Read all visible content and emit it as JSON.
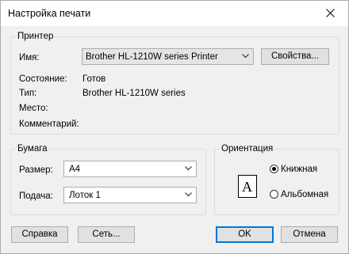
{
  "window": {
    "title": "Настройка печати"
  },
  "printer": {
    "legend": "Принтер",
    "name_label": "Имя:",
    "name_value": "Brother HL-1210W series Printer",
    "properties_label": "Свойства...",
    "status_label": "Состояние:",
    "status_value": "Готов",
    "type_label": "Тип:",
    "type_value": "Brother HL-1210W series",
    "where_label": "Место:",
    "comment_label": "Комментарий:"
  },
  "paper": {
    "legend": "Бумага",
    "size_label": "Размер:",
    "size_value": "A4",
    "source_label": "Подача:",
    "source_value": "Лоток 1"
  },
  "orientation": {
    "legend": "Ориентация",
    "portrait_label": "Книжная",
    "landscape_label": "Альбомная",
    "selected": "portrait",
    "preview_letter": "A"
  },
  "buttons": {
    "help": "Справка",
    "network": "Сеть...",
    "ok": "OK",
    "cancel": "Отмена"
  }
}
